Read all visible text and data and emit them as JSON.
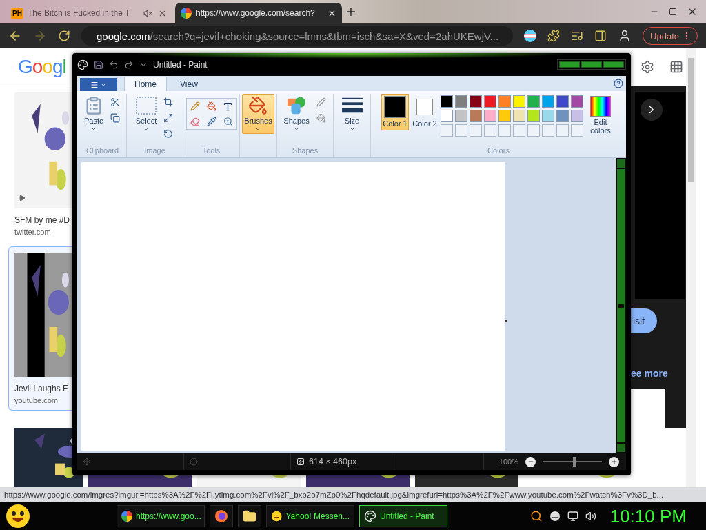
{
  "browser": {
    "tabs": [
      {
        "title": "The Bitch is Fucked in the T",
        "favicon": "PH",
        "selected": false,
        "muted": true
      },
      {
        "title": "https://www.google.com/search?",
        "selected": true
      }
    ],
    "address": {
      "domain": "google.com",
      "path": "/search?q=jevil+choking&source=lnms&tbm=isch&sa=X&ved=2ahUKEwjV..."
    },
    "update": "Update"
  },
  "google": {
    "logo": "Googl",
    "results": [
      {
        "title": "SFM by me #D",
        "source": "twitter.com",
        "selected": false,
        "kind": "picture"
      },
      {
        "title": "Jevil Laughs F",
        "source": "youtube.com",
        "selected": true,
        "kind": "picture"
      }
    ],
    "panel": {
      "visit": "isit",
      "more": "ee more"
    }
  },
  "status_url": "https://www.google.com/imgres?imgurl=https%3A%2F%2Fi.ytimg.com%2Fvi%2F_bxb2o7mZp0%2Fhqdefault.jpg&imgrefurl=https%3A%2F%2Fwww.youtube.com%2Fwatch%3Fv%3D_b...",
  "paint": {
    "title": "Untitled - Paint",
    "tabs": [
      {
        "label": "Home",
        "selected": true
      },
      {
        "label": "View",
        "selected": false
      }
    ],
    "clipboard": {
      "label": "Clipboard",
      "paste": "Paste"
    },
    "image": {
      "label": "Image",
      "select": "Select"
    },
    "tools": {
      "label": "Tools"
    },
    "brushes": {
      "label": "Brushes",
      "selected": true
    },
    "shapes": {
      "label": "Shapes",
      "button": "Shapes"
    },
    "size": {
      "label": "Size"
    },
    "colors": {
      "label": "Colors",
      "edit": "Edit colors",
      "slots": [
        {
          "label": "Color 1",
          "color": "#000000",
          "selected": true
        },
        {
          "label": "Color 2",
          "color": "#ffffff",
          "selected": false
        }
      ],
      "palette": [
        {
          "color": "#000000"
        },
        {
          "color": "#7f7f7f"
        },
        {
          "color": "#880015"
        },
        {
          "color": "#ed1c24"
        },
        {
          "color": "#ff7f27"
        },
        {
          "color": "#fff200"
        },
        {
          "color": "#22b14c"
        },
        {
          "color": "#00a2e8"
        },
        {
          "color": "#3f48cc"
        },
        {
          "color": "#a349a4"
        },
        {
          "color": "#ffffff"
        },
        {
          "color": "#c3c3c3"
        },
        {
          "color": "#b97a57"
        },
        {
          "color": "#ffaec9"
        },
        {
          "color": "#ffc90e"
        },
        {
          "color": "#efe4b0"
        },
        {
          "color": "#b5e61d"
        },
        {
          "color": "#99d9ea"
        },
        {
          "color": "#7092be"
        },
        {
          "color": "#c8bfe7"
        }
      ]
    },
    "status": {
      "size": "614 × 460px",
      "zoom": {
        "reading": "100%",
        "level": 0.55
      }
    }
  },
  "taskbar": {
    "items": [
      {
        "kind": "chrome",
        "label": "https://www.goo...",
        "selected": false
      },
      {
        "kind": "firefox",
        "selected": false
      },
      {
        "kind": "folder",
        "selected": false
      },
      {
        "kind": "yahoo",
        "label": "Yahoo! Messen...",
        "selected": false
      },
      {
        "kind": "paint",
        "label": "Untitled - Paint",
        "selected": true
      }
    ],
    "clock": "10:10 PM"
  }
}
